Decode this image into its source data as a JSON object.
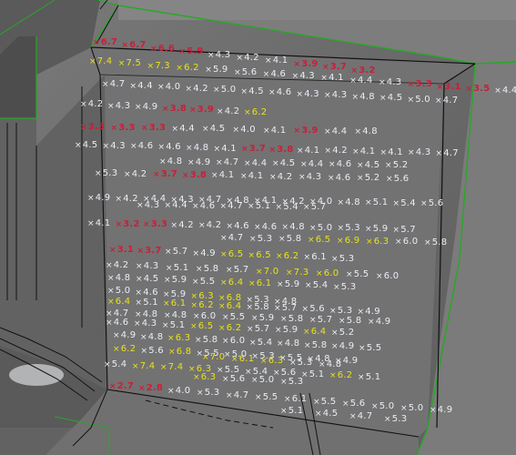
{
  "viewer": {
    "name": "terrain-3d-view"
  },
  "colors": {
    "edge": "#27a827",
    "white": "#e9edf6",
    "yellow": "#e9e219",
    "red": "#c8203a",
    "marker": "×"
  },
  "rows": [
    {
      "values": [
        {
          "v": "6.7",
          "c": "red"
        },
        {
          "v": "6.7",
          "c": "red"
        },
        {
          "v": "6.6",
          "c": "red"
        },
        {
          "v": "5.9",
          "c": "red"
        },
        {
          "v": "4.3",
          "c": "white"
        },
        {
          "v": "4.2",
          "c": "white"
        },
        {
          "v": "4.1",
          "c": "white"
        },
        {
          "v": "3.9",
          "c": "red"
        },
        {
          "v": "3.7",
          "c": "red"
        },
        {
          "v": "3.2",
          "c": "red"
        }
      ]
    },
    {
      "values": [
        {
          "v": "7.4",
          "c": "yellow"
        },
        {
          "v": "7.5",
          "c": "yellow"
        },
        {
          "v": "7.3",
          "c": "yellow"
        },
        {
          "v": "6.2",
          "c": "yellow"
        },
        {
          "v": "5.9",
          "c": "white"
        },
        {
          "v": "5.6",
          "c": "white"
        },
        {
          "v": "4.6",
          "c": "white"
        },
        {
          "v": "4.3",
          "c": "white"
        },
        {
          "v": "4.1",
          "c": "white"
        },
        {
          "v": "4.4",
          "c": "white"
        },
        {
          "v": "4.3",
          "c": "white"
        },
        {
          "v": "3.3",
          "c": "red"
        },
        {
          "v": "3.1",
          "c": "red"
        },
        {
          "v": "3.5",
          "c": "red"
        },
        {
          "v": "4.4",
          "c": "white"
        }
      ]
    },
    {
      "values": [
        {
          "v": "4.7",
          "c": "white"
        },
        {
          "v": "4.4",
          "c": "white"
        },
        {
          "v": "4.0",
          "c": "white"
        },
        {
          "v": "4.2",
          "c": "white"
        },
        {
          "v": "5.0",
          "c": "white"
        },
        {
          "v": "4.5",
          "c": "white"
        },
        {
          "v": "4.6",
          "c": "white"
        },
        {
          "v": "4.3",
          "c": "white"
        },
        {
          "v": "4.3",
          "c": "white"
        },
        {
          "v": "4.8",
          "c": "white"
        },
        {
          "v": "4.5",
          "c": "white"
        },
        {
          "v": "5.0",
          "c": "white"
        },
        {
          "v": "4.7",
          "c": "white"
        }
      ]
    },
    {
      "values": [
        {
          "v": "4.2",
          "c": "white"
        },
        {
          "v": "4.3",
          "c": "white"
        },
        {
          "v": "4.9",
          "c": "white"
        },
        {
          "v": "3.8",
          "c": "red"
        },
        {
          "v": "3.9",
          "c": "red"
        },
        {
          "v": "4.2",
          "c": "white"
        },
        {
          "v": "6.2",
          "c": "yellow"
        }
      ]
    },
    {
      "values": [
        {
          "v": "3.3",
          "c": "red"
        },
        {
          "v": "3.3",
          "c": "red"
        },
        {
          "v": "3.3",
          "c": "red"
        },
        {
          "v": "4.4",
          "c": "white"
        },
        {
          "v": "4.5",
          "c": "white"
        },
        {
          "v": "4.0",
          "c": "white"
        },
        {
          "v": "4.1",
          "c": "white"
        },
        {
          "v": "3.9",
          "c": "red"
        },
        {
          "v": "4.4",
          "c": "white"
        },
        {
          "v": "4.8",
          "c": "white"
        }
      ]
    },
    {
      "values": [
        {
          "v": "4.5",
          "c": "white"
        },
        {
          "v": "4.3",
          "c": "white"
        },
        {
          "v": "4.6",
          "c": "white"
        },
        {
          "v": "4.6",
          "c": "white"
        },
        {
          "v": "4.8",
          "c": "white"
        },
        {
          "v": "4.1",
          "c": "white"
        },
        {
          "v": "3.7",
          "c": "red"
        },
        {
          "v": "3.8",
          "c": "red"
        },
        {
          "v": "4.1",
          "c": "white"
        },
        {
          "v": "4.2",
          "c": "white"
        },
        {
          "v": "4.1",
          "c": "white"
        },
        {
          "v": "4.1",
          "c": "white"
        },
        {
          "v": "4.3",
          "c": "white"
        },
        {
          "v": "4.7",
          "c": "white"
        }
      ]
    },
    {
      "values": [
        {
          "v": "4.8",
          "c": "white"
        },
        {
          "v": "4.9",
          "c": "white"
        },
        {
          "v": "4.7",
          "c": "white"
        },
        {
          "v": "4.4",
          "c": "white"
        },
        {
          "v": "4.5",
          "c": "white"
        },
        {
          "v": "4.4",
          "c": "white"
        },
        {
          "v": "4.6",
          "c": "white"
        },
        {
          "v": "4.5",
          "c": "white"
        },
        {
          "v": "5.2",
          "c": "white"
        }
      ]
    },
    {
      "values": [
        {
          "v": "5.3",
          "c": "white"
        },
        {
          "v": "4.2",
          "c": "white"
        },
        {
          "v": "3.7",
          "c": "red"
        },
        {
          "v": "3.8",
          "c": "red"
        },
        {
          "v": "4.1",
          "c": "white"
        },
        {
          "v": "4.1",
          "c": "white"
        },
        {
          "v": "4.2",
          "c": "white"
        },
        {
          "v": "4.3",
          "c": "white"
        },
        {
          "v": "4.6",
          "c": "white"
        },
        {
          "v": "5.2",
          "c": "white"
        },
        {
          "v": "5.6",
          "c": "white"
        }
      ]
    },
    {
      "values": [
        {
          "v": "4.9",
          "c": "white"
        },
        {
          "v": "4.2",
          "c": "white"
        },
        {
          "v": "4.4",
          "c": "white"
        },
        {
          "v": "4.3",
          "c": "white"
        },
        {
          "v": "4.7",
          "c": "white"
        },
        {
          "v": "4.8",
          "c": "white"
        },
        {
          "v": "4.1",
          "c": "white"
        },
        {
          "v": "4.2",
          "c": "white"
        },
        {
          "v": "4.0",
          "c": "white"
        },
        {
          "v": "4.8",
          "c": "white"
        },
        {
          "v": "5.1",
          "c": "white"
        },
        {
          "v": "5.4",
          "c": "white"
        },
        {
          "v": "5.6",
          "c": "white"
        }
      ]
    },
    {
      "values": [
        {
          "v": "4.3",
          "c": "white"
        },
        {
          "v": "4.4",
          "c": "white"
        },
        {
          "v": "4.6",
          "c": "white"
        },
        {
          "v": "4.7",
          "c": "white"
        },
        {
          "v": "5.1",
          "c": "white"
        },
        {
          "v": "5.4",
          "c": "white"
        },
        {
          "v": "5.7",
          "c": "white"
        }
      ]
    },
    {
      "values": [
        {
          "v": "4.1",
          "c": "white"
        },
        {
          "v": "3.2",
          "c": "red"
        },
        {
          "v": "3.3",
          "c": "red"
        },
        {
          "v": "4.2",
          "c": "white"
        },
        {
          "v": "4.2",
          "c": "white"
        },
        {
          "v": "4.6",
          "c": "white"
        },
        {
          "v": "4.6",
          "c": "white"
        },
        {
          "v": "4.8",
          "c": "white"
        },
        {
          "v": "5.0",
          "c": "white"
        },
        {
          "v": "5.3",
          "c": "white"
        },
        {
          "v": "5.9",
          "c": "white"
        },
        {
          "v": "5.7",
          "c": "white"
        }
      ]
    },
    {
      "values": [
        {
          "v": "4.7",
          "c": "white"
        },
        {
          "v": "5.3",
          "c": "white"
        },
        {
          "v": "5.8",
          "c": "white"
        },
        {
          "v": "6.5",
          "c": "yellow"
        },
        {
          "v": "6.9",
          "c": "yellow"
        },
        {
          "v": "6.3",
          "c": "yellow"
        },
        {
          "v": "6.0",
          "c": "white"
        },
        {
          "v": "5.8",
          "c": "white"
        }
      ]
    },
    {
      "values": [
        {
          "v": "3.1",
          "c": "red"
        },
        {
          "v": "3.7",
          "c": "red"
        },
        {
          "v": "5.7",
          "c": "white"
        },
        {
          "v": "4.9",
          "c": "white"
        },
        {
          "v": "6.5",
          "c": "yellow"
        },
        {
          "v": "6.5",
          "c": "yellow"
        },
        {
          "v": "6.2",
          "c": "yellow"
        },
        {
          "v": "6.1",
          "c": "white"
        },
        {
          "v": "5.3",
          "c": "white"
        }
      ]
    },
    {
      "values": [
        {
          "v": "4.2",
          "c": "white"
        },
        {
          "v": "4.3",
          "c": "white"
        },
        {
          "v": "5.1",
          "c": "white"
        },
        {
          "v": "5.8",
          "c": "white"
        },
        {
          "v": "5.7",
          "c": "white"
        },
        {
          "v": "7.0",
          "c": "yellow"
        },
        {
          "v": "7.3",
          "c": "yellow"
        },
        {
          "v": "6.0",
          "c": "yellow"
        },
        {
          "v": "5.5",
          "c": "white"
        },
        {
          "v": "6.0",
          "c": "white"
        }
      ]
    },
    {
      "values": [
        {
          "v": "4.8",
          "c": "white"
        },
        {
          "v": "4.5",
          "c": "white"
        },
        {
          "v": "5.9",
          "c": "white"
        },
        {
          "v": "5.5",
          "c": "white"
        },
        {
          "v": "6.4",
          "c": "yellow"
        },
        {
          "v": "6.1",
          "c": "yellow"
        },
        {
          "v": "5.9",
          "c": "white"
        },
        {
          "v": "5.4",
          "c": "white"
        },
        {
          "v": "5.3",
          "c": "white"
        }
      ]
    },
    {
      "values": [
        {
          "v": "5.0",
          "c": "white"
        },
        {
          "v": "4.6",
          "c": "white"
        },
        {
          "v": "5.9",
          "c": "white"
        },
        {
          "v": "6.3",
          "c": "yellow"
        },
        {
          "v": "6.8",
          "c": "yellow"
        },
        {
          "v": "5.3",
          "c": "white"
        },
        {
          "v": "4.8",
          "c": "white"
        }
      ]
    },
    {
      "values": [
        {
          "v": "6.4",
          "c": "yellow"
        },
        {
          "v": "5.1",
          "c": "white"
        },
        {
          "v": "6.1",
          "c": "yellow"
        },
        {
          "v": "6.2",
          "c": "yellow"
        },
        {
          "v": "6.4",
          "c": "yellow"
        },
        {
          "v": "5.8",
          "c": "white"
        },
        {
          "v": "5.7",
          "c": "white"
        },
        {
          "v": "5.6",
          "c": "white"
        },
        {
          "v": "5.3",
          "c": "white"
        },
        {
          "v": "4.9",
          "c": "white"
        }
      ]
    },
    {
      "values": [
        {
          "v": "4.7",
          "c": "white"
        },
        {
          "v": "4.8",
          "c": "white"
        },
        {
          "v": "4.8",
          "c": "white"
        },
        {
          "v": "6.0",
          "c": "white"
        },
        {
          "v": "5.5",
          "c": "white"
        },
        {
          "v": "5.9",
          "c": "white"
        },
        {
          "v": "5.8",
          "c": "white"
        },
        {
          "v": "5.7",
          "c": "white"
        },
        {
          "v": "5.8",
          "c": "white"
        },
        {
          "v": "4.9",
          "c": "white"
        }
      ]
    },
    {
      "values": [
        {
          "v": "4.6",
          "c": "white"
        },
        {
          "v": "4.3",
          "c": "white"
        },
        {
          "v": "5.1",
          "c": "white"
        },
        {
          "v": "6.5",
          "c": "yellow"
        },
        {
          "v": "6.2",
          "c": "yellow"
        },
        {
          "v": "5.7",
          "c": "white"
        },
        {
          "v": "5.9",
          "c": "white"
        },
        {
          "v": "6.4",
          "c": "yellow"
        },
        {
          "v": "5.2",
          "c": "white"
        }
      ]
    },
    {
      "values": [
        {
          "v": "4.9",
          "c": "white"
        },
        {
          "v": "4.8",
          "c": "white"
        },
        {
          "v": "6.3",
          "c": "yellow"
        },
        {
          "v": "5.8",
          "c": "white"
        },
        {
          "v": "6.0",
          "c": "white"
        },
        {
          "v": "5.4",
          "c": "white"
        },
        {
          "v": "4.8",
          "c": "white"
        },
        {
          "v": "5.8",
          "c": "white"
        },
        {
          "v": "4.9",
          "c": "white"
        },
        {
          "v": "5.5",
          "c": "white"
        }
      ]
    },
    {
      "values": [
        {
          "v": "6.2",
          "c": "yellow"
        },
        {
          "v": "5.6",
          "c": "white"
        },
        {
          "v": "6.8",
          "c": "yellow"
        },
        {
          "v": "5.5",
          "c": "white"
        },
        {
          "v": "5.0",
          "c": "white"
        },
        {
          "v": "5.3",
          "c": "white"
        },
        {
          "v": "5.5",
          "c": "white"
        },
        {
          "v": "4.8",
          "c": "white"
        },
        {
          "v": "4.9",
          "c": "white"
        }
      ]
    },
    {
      "values": [
        {
          "v": "7.0",
          "c": "yellow"
        },
        {
          "v": "6.1",
          "c": "yellow"
        },
        {
          "v": "6.3",
          "c": "yellow"
        },
        {
          "v": "5.3",
          "c": "white"
        },
        {
          "v": "4.8",
          "c": "white"
        }
      ]
    },
    {
      "values": [
        {
          "v": "5.4",
          "c": "white"
        },
        {
          "v": "7.4",
          "c": "yellow"
        },
        {
          "v": "7.4",
          "c": "yellow"
        },
        {
          "v": "6.3",
          "c": "yellow"
        },
        {
          "v": "5.5",
          "c": "white"
        },
        {
          "v": "5.4",
          "c": "white"
        },
        {
          "v": "5.6",
          "c": "white"
        },
        {
          "v": "5.1",
          "c": "white"
        },
        {
          "v": "6.2",
          "c": "yellow"
        },
        {
          "v": "5.1",
          "c": "white"
        }
      ]
    },
    {
      "values": [
        {
          "v": "6.3",
          "c": "yellow"
        },
        {
          "v": "5.6",
          "c": "white"
        },
        {
          "v": "5.0",
          "c": "white"
        },
        {
          "v": "5.3",
          "c": "white"
        }
      ]
    },
    {
      "values": [
        {
          "v": "2.7",
          "c": "red"
        },
        {
          "v": "2.8",
          "c": "red"
        },
        {
          "v": "4.0",
          "c": "white"
        },
        {
          "v": "5.3",
          "c": "white"
        },
        {
          "v": "4.7",
          "c": "white"
        },
        {
          "v": "5.5",
          "c": "white"
        },
        {
          "v": "6.1",
          "c": "white"
        },
        {
          "v": "5.5",
          "c": "white"
        },
        {
          "v": "5.6",
          "c": "white"
        },
        {
          "v": "5.0",
          "c": "white"
        },
        {
          "v": "5.0",
          "c": "white"
        },
        {
          "v": "4.9",
          "c": "white"
        }
      ]
    },
    {
      "values": [
        {
          "v": "5.1",
          "c": "white"
        },
        {
          "v": "4.5",
          "c": "white"
        },
        {
          "v": "4.7",
          "c": "white"
        },
        {
          "v": "5.3",
          "c": "white"
        }
      ]
    }
  ]
}
